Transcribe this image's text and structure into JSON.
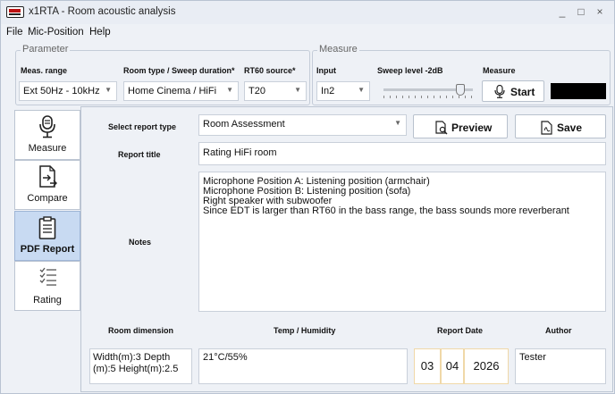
{
  "window": {
    "title": "x1RTA - Room acoustic analysis",
    "minimize_glyph": "_",
    "maximize_glyph": "□",
    "close_glyph": "×"
  },
  "menu": [
    "File",
    "Mic-Position",
    "Help"
  ],
  "parameter": {
    "group_title": "Parameter",
    "meas_range": {
      "label": "Meas. range",
      "value": "Ext 50Hz - 10kHz"
    },
    "room_type": {
      "label": "Room type / Sweep duration*",
      "value": "Home Cinema / HiFi"
    },
    "rt60_source": {
      "label": "RT60 source*",
      "value": "T20"
    }
  },
  "measure": {
    "group_title": "Measure",
    "input": {
      "label": "Input",
      "value": "In2"
    },
    "sweep_level": {
      "label": "Sweep level -2dB",
      "position_fraction": 0.9
    },
    "start": {
      "label": "Measure",
      "button": "Start"
    }
  },
  "tabs": [
    {
      "label": "Measure",
      "icon": "microphone-icon",
      "active": false
    },
    {
      "label": "Compare",
      "icon": "compare-document-icon",
      "active": false
    },
    {
      "label": "PDF Report",
      "icon": "pdf-report-icon",
      "active": true
    },
    {
      "label": "Rating",
      "icon": "checklist-icon",
      "active": false
    }
  ],
  "report": {
    "type_label": "Select report type",
    "type_value": "Room Assessment",
    "preview_button": "Preview",
    "save_button": "Save",
    "title_label": "Report title",
    "title_value": "Rating HiFi room",
    "notes_label": "Notes",
    "notes_lines": [
      "Microphone Position A: Listening position (armchair)",
      "Microphone Position B: Listening position (sofa)",
      "Right speaker with subwoofer",
      "Since EDT is larger than RT60 in the bass range, the bass sounds more reverberant"
    ],
    "room_dimension_label": "Room dimension",
    "room_dimension_value": "Width(m):3 Depth (m):5 Height(m):2.5",
    "temp_label": "Temp / Humidity",
    "temp_value": "21°C/55%",
    "date_label": "Report Date",
    "date": {
      "day": "03",
      "month": "04",
      "year": "2026"
    },
    "author_label": "Author",
    "author_value": "Tester"
  },
  "colors": {
    "active_tab": "#c8daf2",
    "background": "#eef1f6",
    "level_meter": "#000000",
    "date_border": "#f0d8a8"
  }
}
